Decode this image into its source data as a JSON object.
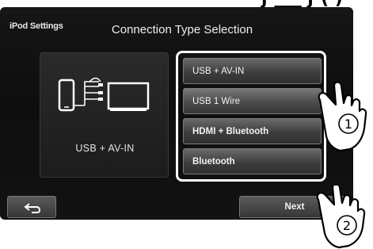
{
  "header": {
    "section_label": "iPod Settings",
    "title": "Connection Type Selection"
  },
  "preview": {
    "label": "USB + AV-IN"
  },
  "options": [
    {
      "label": "USB + AV-IN",
      "selected": false
    },
    {
      "label": "USB 1 Wire",
      "selected": true
    },
    {
      "label": "HDMI + Bluetooth",
      "selected": false
    },
    {
      "label": "Bluetooth",
      "selected": false
    }
  ],
  "footer": {
    "next_label": "Next"
  },
  "callouts": {
    "step_1": "1",
    "step_2": "2"
  },
  "colors": {
    "screen_bg": "#121212",
    "button_top": "#6a6a6a",
    "button_bottom": "#2f2f2f",
    "highlight_frame": "#ffffff"
  }
}
